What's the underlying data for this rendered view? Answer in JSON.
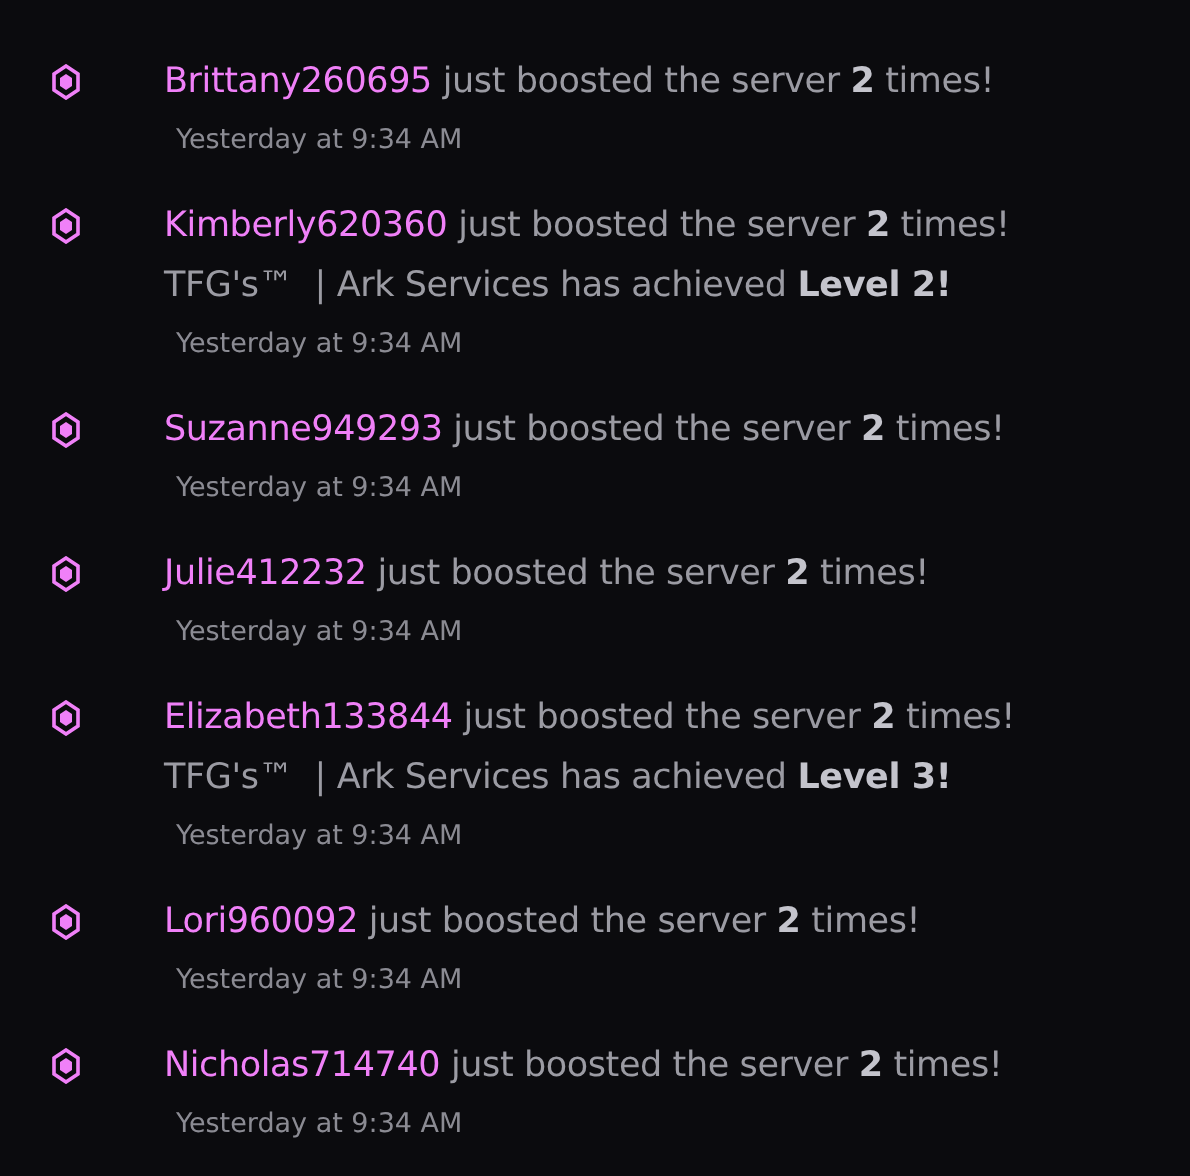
{
  "messages": [
    {
      "user": "Brittany260695",
      "text": "just boosted the server **2** times!",
      "timestamp": "Yesterday at 9:34 AM"
    },
    {
      "user": "Kimberly620360",
      "text": "just boosted the server **2** times!",
      "achievement": "TFG's™  | Ark Services has achieved **Level 2!**",
      "timestamp": "Yesterday at 9:34 AM"
    },
    {
      "user": "Suzanne949293",
      "text": "just boosted the server **2** times!",
      "timestamp": "Yesterday at 9:34 AM"
    },
    {
      "user": "Julie412232",
      "text": "just boosted the server **2** times!",
      "timestamp": "Yesterday at 9:34 AM"
    },
    {
      "user": "Elizabeth133844",
      "text": "just boosted the server **2** times!",
      "achievement": "TFG's™  | Ark Services has achieved **Level 3!**",
      "timestamp": "Yesterday at 9:34 AM"
    },
    {
      "user": "Lori960092",
      "text": "just boosted the server **2** times!",
      "timestamp": "Yesterday at 9:34 AM"
    },
    {
      "user": "Nicholas714740",
      "text": "just boosted the server **2** times!",
      "timestamp": "Yesterday at 9:34 AM"
    }
  ]
}
